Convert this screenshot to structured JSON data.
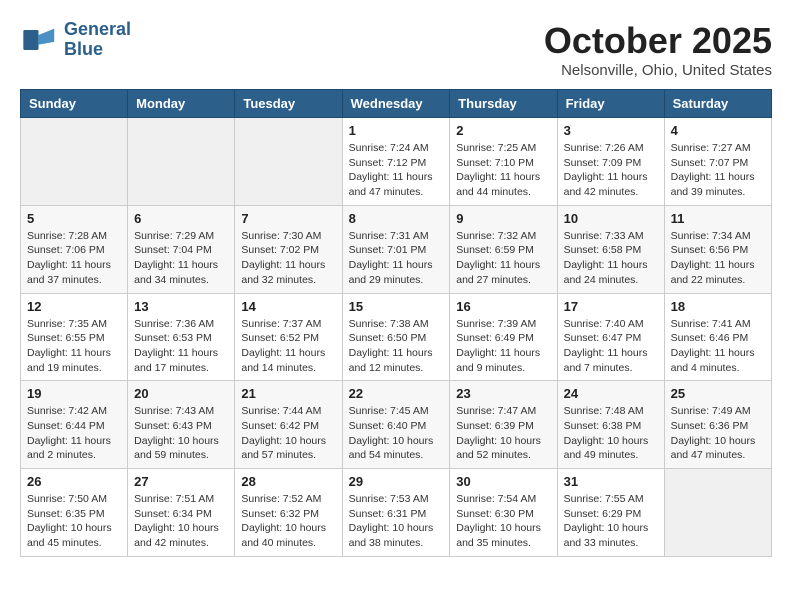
{
  "header": {
    "logo_line1": "General",
    "logo_line2": "Blue",
    "month": "October 2025",
    "location": "Nelsonville, Ohio, United States"
  },
  "weekdays": [
    "Sunday",
    "Monday",
    "Tuesday",
    "Wednesday",
    "Thursday",
    "Friday",
    "Saturday"
  ],
  "weeks": [
    [
      {
        "day": "",
        "info": ""
      },
      {
        "day": "",
        "info": ""
      },
      {
        "day": "",
        "info": ""
      },
      {
        "day": "1",
        "info": "Sunrise: 7:24 AM\nSunset: 7:12 PM\nDaylight: 11 hours and 47 minutes."
      },
      {
        "day": "2",
        "info": "Sunrise: 7:25 AM\nSunset: 7:10 PM\nDaylight: 11 hours and 44 minutes."
      },
      {
        "day": "3",
        "info": "Sunrise: 7:26 AM\nSunset: 7:09 PM\nDaylight: 11 hours and 42 minutes."
      },
      {
        "day": "4",
        "info": "Sunrise: 7:27 AM\nSunset: 7:07 PM\nDaylight: 11 hours and 39 minutes."
      }
    ],
    [
      {
        "day": "5",
        "info": "Sunrise: 7:28 AM\nSunset: 7:06 PM\nDaylight: 11 hours and 37 minutes."
      },
      {
        "day": "6",
        "info": "Sunrise: 7:29 AM\nSunset: 7:04 PM\nDaylight: 11 hours and 34 minutes."
      },
      {
        "day": "7",
        "info": "Sunrise: 7:30 AM\nSunset: 7:02 PM\nDaylight: 11 hours and 32 minutes."
      },
      {
        "day": "8",
        "info": "Sunrise: 7:31 AM\nSunset: 7:01 PM\nDaylight: 11 hours and 29 minutes."
      },
      {
        "day": "9",
        "info": "Sunrise: 7:32 AM\nSunset: 6:59 PM\nDaylight: 11 hours and 27 minutes."
      },
      {
        "day": "10",
        "info": "Sunrise: 7:33 AM\nSunset: 6:58 PM\nDaylight: 11 hours and 24 minutes."
      },
      {
        "day": "11",
        "info": "Sunrise: 7:34 AM\nSunset: 6:56 PM\nDaylight: 11 hours and 22 minutes."
      }
    ],
    [
      {
        "day": "12",
        "info": "Sunrise: 7:35 AM\nSunset: 6:55 PM\nDaylight: 11 hours and 19 minutes."
      },
      {
        "day": "13",
        "info": "Sunrise: 7:36 AM\nSunset: 6:53 PM\nDaylight: 11 hours and 17 minutes."
      },
      {
        "day": "14",
        "info": "Sunrise: 7:37 AM\nSunset: 6:52 PM\nDaylight: 11 hours and 14 minutes."
      },
      {
        "day": "15",
        "info": "Sunrise: 7:38 AM\nSunset: 6:50 PM\nDaylight: 11 hours and 12 minutes."
      },
      {
        "day": "16",
        "info": "Sunrise: 7:39 AM\nSunset: 6:49 PM\nDaylight: 11 hours and 9 minutes."
      },
      {
        "day": "17",
        "info": "Sunrise: 7:40 AM\nSunset: 6:47 PM\nDaylight: 11 hours and 7 minutes."
      },
      {
        "day": "18",
        "info": "Sunrise: 7:41 AM\nSunset: 6:46 PM\nDaylight: 11 hours and 4 minutes."
      }
    ],
    [
      {
        "day": "19",
        "info": "Sunrise: 7:42 AM\nSunset: 6:44 PM\nDaylight: 11 hours and 2 minutes."
      },
      {
        "day": "20",
        "info": "Sunrise: 7:43 AM\nSunset: 6:43 PM\nDaylight: 10 hours and 59 minutes."
      },
      {
        "day": "21",
        "info": "Sunrise: 7:44 AM\nSunset: 6:42 PM\nDaylight: 10 hours and 57 minutes."
      },
      {
        "day": "22",
        "info": "Sunrise: 7:45 AM\nSunset: 6:40 PM\nDaylight: 10 hours and 54 minutes."
      },
      {
        "day": "23",
        "info": "Sunrise: 7:47 AM\nSunset: 6:39 PM\nDaylight: 10 hours and 52 minutes."
      },
      {
        "day": "24",
        "info": "Sunrise: 7:48 AM\nSunset: 6:38 PM\nDaylight: 10 hours and 49 minutes."
      },
      {
        "day": "25",
        "info": "Sunrise: 7:49 AM\nSunset: 6:36 PM\nDaylight: 10 hours and 47 minutes."
      }
    ],
    [
      {
        "day": "26",
        "info": "Sunrise: 7:50 AM\nSunset: 6:35 PM\nDaylight: 10 hours and 45 minutes."
      },
      {
        "day": "27",
        "info": "Sunrise: 7:51 AM\nSunset: 6:34 PM\nDaylight: 10 hours and 42 minutes."
      },
      {
        "day": "28",
        "info": "Sunrise: 7:52 AM\nSunset: 6:32 PM\nDaylight: 10 hours and 40 minutes."
      },
      {
        "day": "29",
        "info": "Sunrise: 7:53 AM\nSunset: 6:31 PM\nDaylight: 10 hours and 38 minutes."
      },
      {
        "day": "30",
        "info": "Sunrise: 7:54 AM\nSunset: 6:30 PM\nDaylight: 10 hours and 35 minutes."
      },
      {
        "day": "31",
        "info": "Sunrise: 7:55 AM\nSunset: 6:29 PM\nDaylight: 10 hours and 33 minutes."
      },
      {
        "day": "",
        "info": ""
      }
    ]
  ]
}
